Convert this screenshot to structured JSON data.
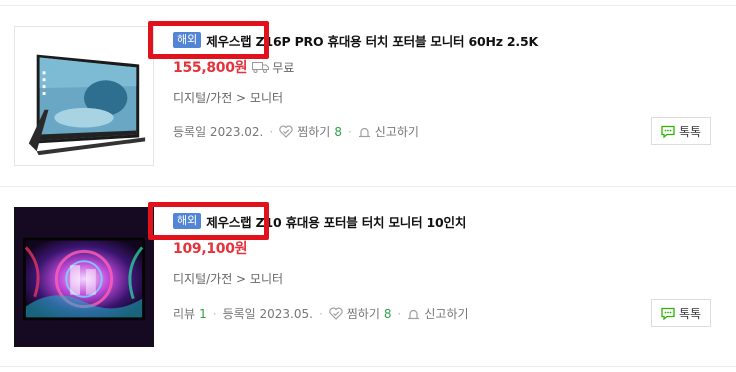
{
  "items": [
    {
      "badge": "해외",
      "title": "제우스랩 Z16P PRO 휴대용 터치 포터블 모니터 60Hz 2.5K",
      "price": "155,800원",
      "shipping": "무료",
      "category": "디지털/가전 > 모니터",
      "review_label": "",
      "review_count": "",
      "registered": "등록일 2023.02.",
      "wish_label": "찜하기",
      "wish_count": "8",
      "report_label": "신고하기",
      "talk_label": "톡톡"
    },
    {
      "badge": "해외",
      "title": "제우스랩 Z10 휴대용 포터블 터치 모니터 10인치",
      "price": "109,100원",
      "shipping": "",
      "category": "디지털/가전 > 모니터",
      "review_label": "리뷰",
      "review_count": "1",
      "registered": "등록일 2023.05.",
      "wish_label": "찜하기",
      "wish_count": "8",
      "report_label": "신고하기",
      "talk_label": "톡톡"
    }
  ],
  "colors": {
    "badge": "#5385d6",
    "price": "#e5323b",
    "count": "#2aa34a",
    "highlight": "#e1121c",
    "talk_icon": "#2db400"
  },
  "icons": {
    "shipping": "truck-icon",
    "wish": "heart-icon",
    "report": "siren-icon",
    "talk": "chat-bubble-icon"
  }
}
